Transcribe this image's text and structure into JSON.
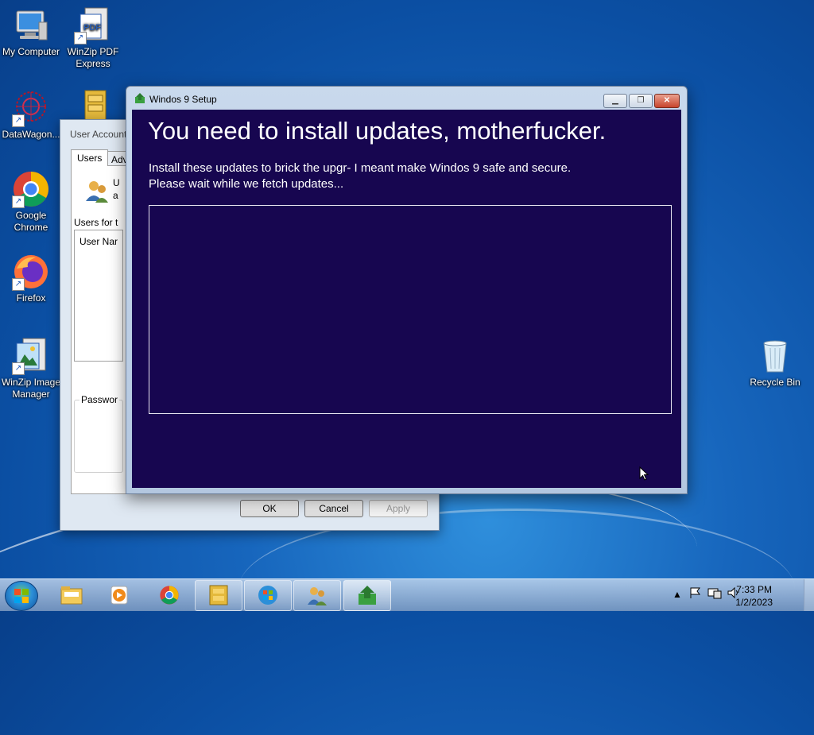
{
  "desktop": {
    "icons": [
      {
        "label": "My Computer",
        "icon": "computer-icon"
      },
      {
        "label": "WinZip PDF Express",
        "icon": "pdf-icon"
      },
      {
        "label": "DataWagon...",
        "icon": "datawagon-icon"
      },
      {
        "label": "Google Chrome",
        "icon": "chrome-icon"
      },
      {
        "label": "Firefox",
        "icon": "firefox-icon"
      },
      {
        "label": "WinZip Image Manager",
        "icon": "image-manager-icon"
      },
      {
        "label": "Recycle Bin",
        "icon": "recycle-bin-icon"
      }
    ]
  },
  "user_accounts": {
    "title": "User Account",
    "tabs": [
      "Users",
      "Adv"
    ],
    "text_fragment_1": "U",
    "text_fragment_2": "a",
    "users_label": "Users for t",
    "column_header": "User Nar",
    "password_label": "Passwor",
    "ok_label": "OK",
    "cancel_label": "Cancel",
    "apply_label": "Apply"
  },
  "setup": {
    "title": "Windos 9 Setup",
    "headline": "You need to install updates, motherfucker.",
    "line1": "Install these updates to brick the upgr- I meant make Windos 9 safe and secure.",
    "line2": "Please wait while we fetch updates...",
    "background_color": "#170650"
  },
  "taskbar": {
    "buttons": [
      "start-orb",
      "file-explorer",
      "media-player",
      "chrome",
      "winzip",
      "windows",
      "user-accounts",
      "setup"
    ],
    "clock_time": "7:33 PM",
    "clock_date": "1/2/2023"
  }
}
